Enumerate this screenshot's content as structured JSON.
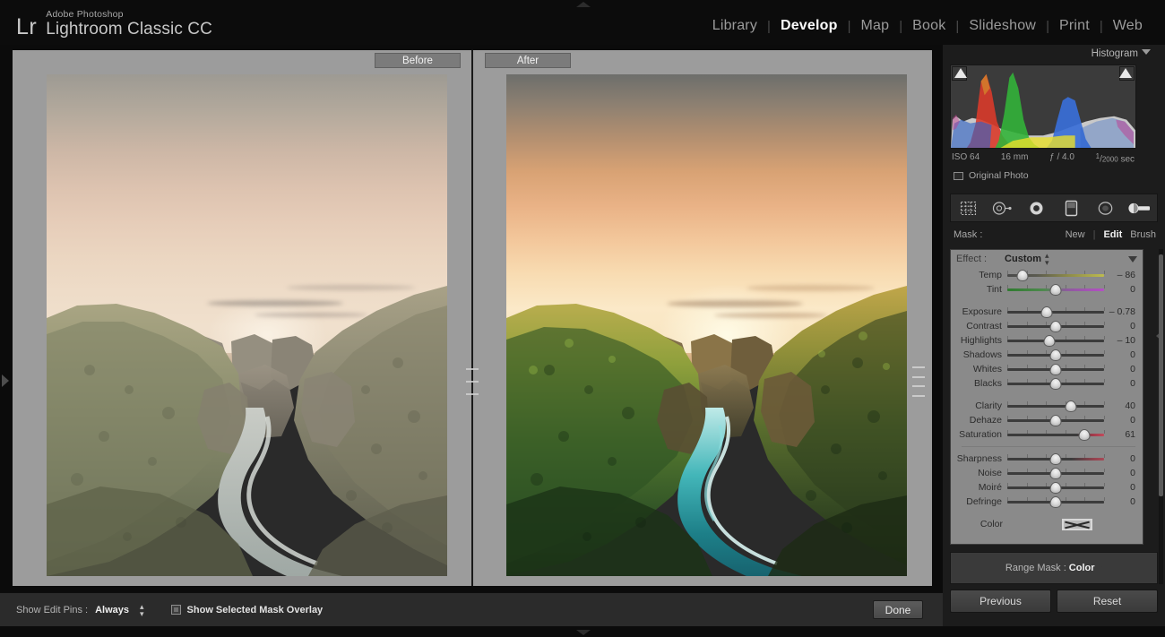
{
  "app": {
    "brand_icon": "Lr",
    "brand_line1": "Adobe Photoshop",
    "brand_line2": "Lightroom Classic CC"
  },
  "modules": {
    "separator": "|",
    "items": [
      {
        "label": "Library",
        "active": false
      },
      {
        "label": "Develop",
        "active": true
      },
      {
        "label": "Map",
        "active": false
      },
      {
        "label": "Book",
        "active": false
      },
      {
        "label": "Slideshow",
        "active": false
      },
      {
        "label": "Print",
        "active": false
      },
      {
        "label": "Web",
        "active": false
      }
    ]
  },
  "compare_view": {
    "before_label": "Before",
    "after_label": "After"
  },
  "histogram": {
    "title": "Histogram",
    "metadata": {
      "iso": "ISO 64",
      "focal_length": "16 mm",
      "aperture": "ƒ / 4.0",
      "shutter_numerator": "1",
      "shutter_denominator": "2000",
      "shutter_unit": "sec"
    },
    "original_photo_label": "Original Photo",
    "original_photo_checked": false
  },
  "tool_strip": {
    "tools": [
      {
        "name": "crop-overlay-tool",
        "selected": false
      },
      {
        "name": "spot-removal-tool",
        "selected": false
      },
      {
        "name": "red-eye-correction-tool",
        "selected": false
      },
      {
        "name": "graduated-filter-tool",
        "selected": false
      },
      {
        "name": "radial-filter-tool",
        "selected": false
      },
      {
        "name": "adjustment-brush-tool",
        "selected": true
      }
    ]
  },
  "mask_bar": {
    "label": "Mask :",
    "new_label": "New",
    "separator": "|",
    "edit_label": "Edit",
    "brush_label": "Brush",
    "active": "Edit"
  },
  "effect_panel": {
    "effect_label": "Effect :",
    "effect_value": "Custom",
    "groups": [
      {
        "name": "white-balance",
        "sliders": [
          {
            "label": "Temp",
            "value": "– 86",
            "pos": 0.16,
            "track": "temp"
          },
          {
            "label": "Tint",
            "value": "0",
            "pos": 0.5,
            "track": "tint"
          }
        ]
      },
      {
        "name": "tone",
        "sliders": [
          {
            "label": "Exposure",
            "value": "– 0.78",
            "pos": 0.41,
            "track": "plain"
          },
          {
            "label": "Contrast",
            "value": "0",
            "pos": 0.5,
            "track": "plain"
          },
          {
            "label": "Highlights",
            "value": "– 10",
            "pos": 0.44,
            "track": "plain"
          },
          {
            "label": "Shadows",
            "value": "0",
            "pos": 0.5,
            "track": "plain"
          },
          {
            "label": "Whites",
            "value": "0",
            "pos": 0.5,
            "track": "plain"
          },
          {
            "label": "Blacks",
            "value": "0",
            "pos": 0.5,
            "track": "plain"
          }
        ]
      },
      {
        "name": "presence",
        "sliders": [
          {
            "label": "Clarity",
            "value": "40",
            "pos": 0.66,
            "track": "plain"
          },
          {
            "label": "Dehaze",
            "value": "0",
            "pos": 0.5,
            "track": "plain"
          },
          {
            "label": "Saturation",
            "value": "61",
            "pos": 0.8,
            "track": "sat"
          }
        ]
      },
      {
        "name": "detail",
        "sliders": [
          {
            "label": "Sharpness",
            "value": "0",
            "pos": 0.5,
            "track": "sharp"
          },
          {
            "label": "Noise",
            "value": "0",
            "pos": 0.5,
            "track": "plain"
          },
          {
            "label": "Moiré",
            "value": "0",
            "pos": 0.5,
            "track": "plain"
          },
          {
            "label": "Defringe",
            "value": "0",
            "pos": 0.5,
            "track": "plain"
          }
        ]
      }
    ],
    "color_label": "Color",
    "color_swatch_state": "none"
  },
  "range_mask": {
    "label": "Range Mask :",
    "value": "Color"
  },
  "panel_buttons": {
    "previous": "Previous",
    "reset": "Reset"
  },
  "toolbar": {
    "edit_pins_label": "Show Edit Pins :",
    "edit_pins_value": "Always",
    "mask_overlay_label": "Show Selected Mask Overlay",
    "mask_overlay_checked": true,
    "done_label": "Done"
  },
  "colors": {
    "chrome_dark": "#0c0c0c",
    "panel_bg": "#1c1c1c",
    "effect_panel_bg": "#8a8a8a",
    "canvas_bg": "#9a9a9a",
    "text_primary": "#d8d8d8",
    "text_muted": "#9b9b9b",
    "active_module": "#fdfdfd"
  }
}
